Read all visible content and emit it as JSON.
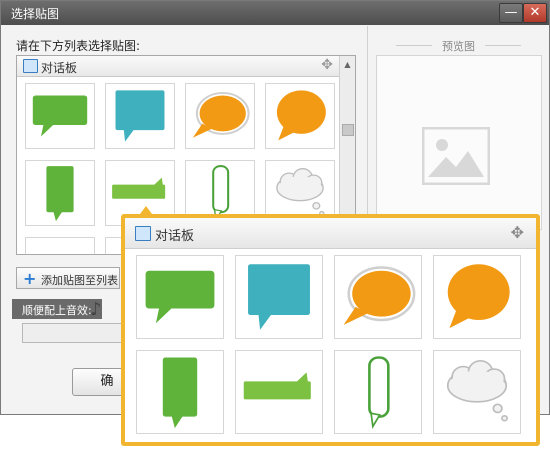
{
  "window": {
    "title": "选择贴图",
    "min_label": "—",
    "close_label": "✕"
  },
  "instruction": "请在下方列表选择贴图:",
  "category": {
    "title": "对话板",
    "move_icon": "✥"
  },
  "stickers": [
    {
      "name": "green-rect-bubble",
      "shape": "rect-bubble",
      "color": "#5fb33a"
    },
    {
      "name": "teal-square-bubble",
      "shape": "square-bubble",
      "color": "#3fb0bd"
    },
    {
      "name": "orange-oval-bubble-left",
      "shape": "oval-left",
      "color": "#f29a14"
    },
    {
      "name": "orange-oval-bubble-right",
      "shape": "oval-right",
      "color": "#f29a14"
    },
    {
      "name": "green-tall-bubble",
      "shape": "tall-bubble",
      "color": "#5fb33a"
    },
    {
      "name": "green-banner-bubble",
      "shape": "banner",
      "color": "#7cc142"
    },
    {
      "name": "green-outline-bubble",
      "shape": "outline-tall",
      "color": "#4aa13a"
    },
    {
      "name": "cloud-bubble",
      "shape": "cloud",
      "color": "#f2f2f2"
    }
  ],
  "buttons": {
    "add": "添加贴图至列表",
    "ok": "确"
  },
  "music_label": "顺便配上音效:",
  "music_icon": "♪",
  "preview_label": "预览图",
  "colors": {
    "accent": "#f2b530",
    "titlebar": "#5a5a5a",
    "close": "#c0463a"
  }
}
